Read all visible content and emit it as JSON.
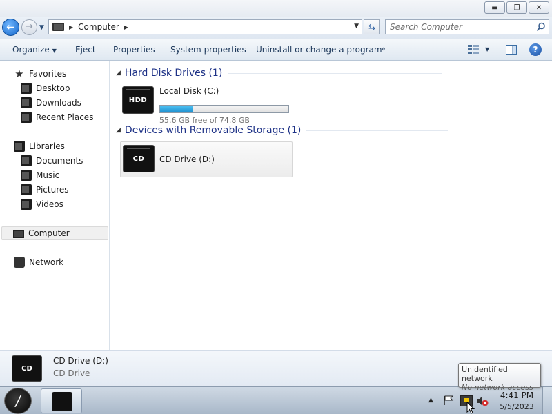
{
  "window": {
    "minimize_glyph": "▬",
    "restore_glyph": "❐",
    "close_glyph": "✕"
  },
  "address": {
    "location": "Computer",
    "search_placeholder": "Search Computer"
  },
  "toolbar": {
    "organize": "Organize",
    "eject": "Eject",
    "properties": "Properties",
    "system_properties": "System properties",
    "uninstall": "Uninstall or change a program",
    "more": "»"
  },
  "nav": {
    "favorites": "Favorites",
    "desktop": "Desktop",
    "downloads": "Downloads",
    "recent_places": "Recent Places",
    "libraries": "Libraries",
    "documents": "Documents",
    "music": "Music",
    "pictures": "Pictures",
    "videos": "Videos",
    "computer": "Computer",
    "network": "Network"
  },
  "content": {
    "hdd_group": "Hard Disk Drives (1)",
    "removable_group": "Devices with Removable Storage (1)",
    "local_disk": {
      "name": "Local Disk (C:)",
      "icon_label": "HDD",
      "free_text": "55.6 GB free of 74.8 GB",
      "used_fraction": 0.257
    },
    "cd_drive": {
      "name": "CD Drive (D:)",
      "icon_label": "CD"
    }
  },
  "details": {
    "name": "CD Drive (D:)",
    "type": "CD Drive",
    "icon_label": "CD"
  },
  "tooltip": {
    "title": "Unidentified network",
    "subtitle": "No network access"
  },
  "taskbar": {
    "time": "4:41 PM",
    "date": "5/5/2023"
  },
  "colors": {
    "accent": "#1e3287",
    "progress": "#26a0da",
    "toolbar_text": "#1e395b"
  }
}
